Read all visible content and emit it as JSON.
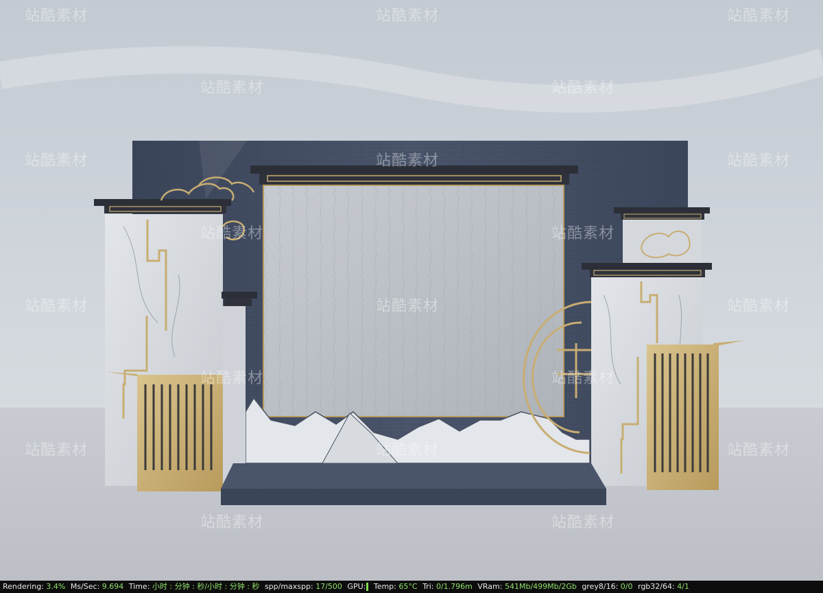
{
  "watermark": "站酷素材",
  "status": {
    "rendering_label": "Rendering:",
    "rendering_value": "3.4%",
    "mspersec_label": "Ms/Sec:",
    "mspersec_value": "9.694",
    "time_label": "Time:",
    "time_value": "小时 : 分钟 : 秒/小时 : 分钟 : 秒",
    "spp_label": "spp/maxspp:",
    "spp_value": "17/500",
    "gpu_label": "GPU:",
    "temp_label": "Temp:",
    "temp_value": "65°C",
    "tri_label": "Tri:",
    "tri_value": "0/1.796m",
    "vram_label": "VRam:",
    "vram_value": "541Mb/499Mb/2Gb",
    "grey_label": "grey8/16:",
    "grey_value": "0/0",
    "rgb_label": "rgb32/64:",
    "rgb_value": "4/1"
  },
  "colors": {
    "sky": "#c9cfd6",
    "floor": "#c2c6cc",
    "navy_wall": "#414c62",
    "marble": "#d7dbe0",
    "wood_panel": "#bfc3c9",
    "gold": "#c8ad72",
    "cornice": "#2c2f38",
    "stage": "#3f4a5e",
    "status_bg": "#0d0d0d",
    "status_value": "#8fe06a"
  },
  "icons": [
    "cloud-ornament-icon",
    "lattice-window-icon",
    "mountain-silhouette-icon",
    "gold-screen-icon"
  ]
}
